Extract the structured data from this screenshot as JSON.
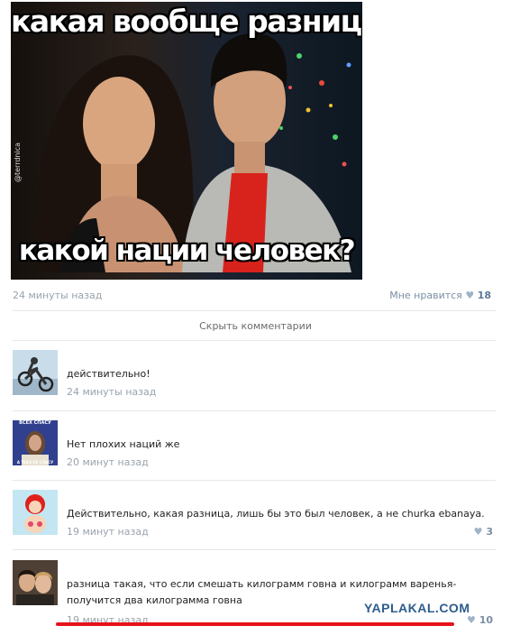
{
  "post": {
    "meme_top": "какая вообще разница",
    "meme_bottom": "какой нации человек?",
    "meme_watermark": "@terrdnica",
    "time": "24 минуты назад",
    "like_label": "Мне нравится",
    "like_count": "18"
  },
  "hide_comments": "Скрыть комментарии",
  "comments": [
    {
      "text": "действительно!",
      "time": "24 минуты назад",
      "likes": "",
      "avatar_icon": "motocross-icon"
    },
    {
      "text": "Нет плохих наций же",
      "time": "20 минут назад",
      "likes": "",
      "avatar_icon": "jesus-image-icon",
      "avatar_caption_top": "ВСЕХ СПАСУ",
      "avatar_caption_bottom": "А ТЕБЯ НЕ СПАСУ"
    },
    {
      "text": "Действительно, какая разница, лишь бы это был человек, а не churka ebanaya.",
      "time": "19 минут назад",
      "likes": "3",
      "avatar_icon": "cartoon-girl-icon"
    },
    {
      "text_line1": "разница такая, что если смешать килограмм говна и килограмм варенья-",
      "text_line2": "получится два килограмма говна",
      "time": "19 минут назад",
      "likes": "10",
      "avatar_icon": "couple-photo-icon"
    }
  ],
  "watermark": "YAPLAKAL.COM",
  "colors": {
    "accent": "#2d5c8c",
    "underline": "#e5121b",
    "meta": "#9aa3ad"
  }
}
